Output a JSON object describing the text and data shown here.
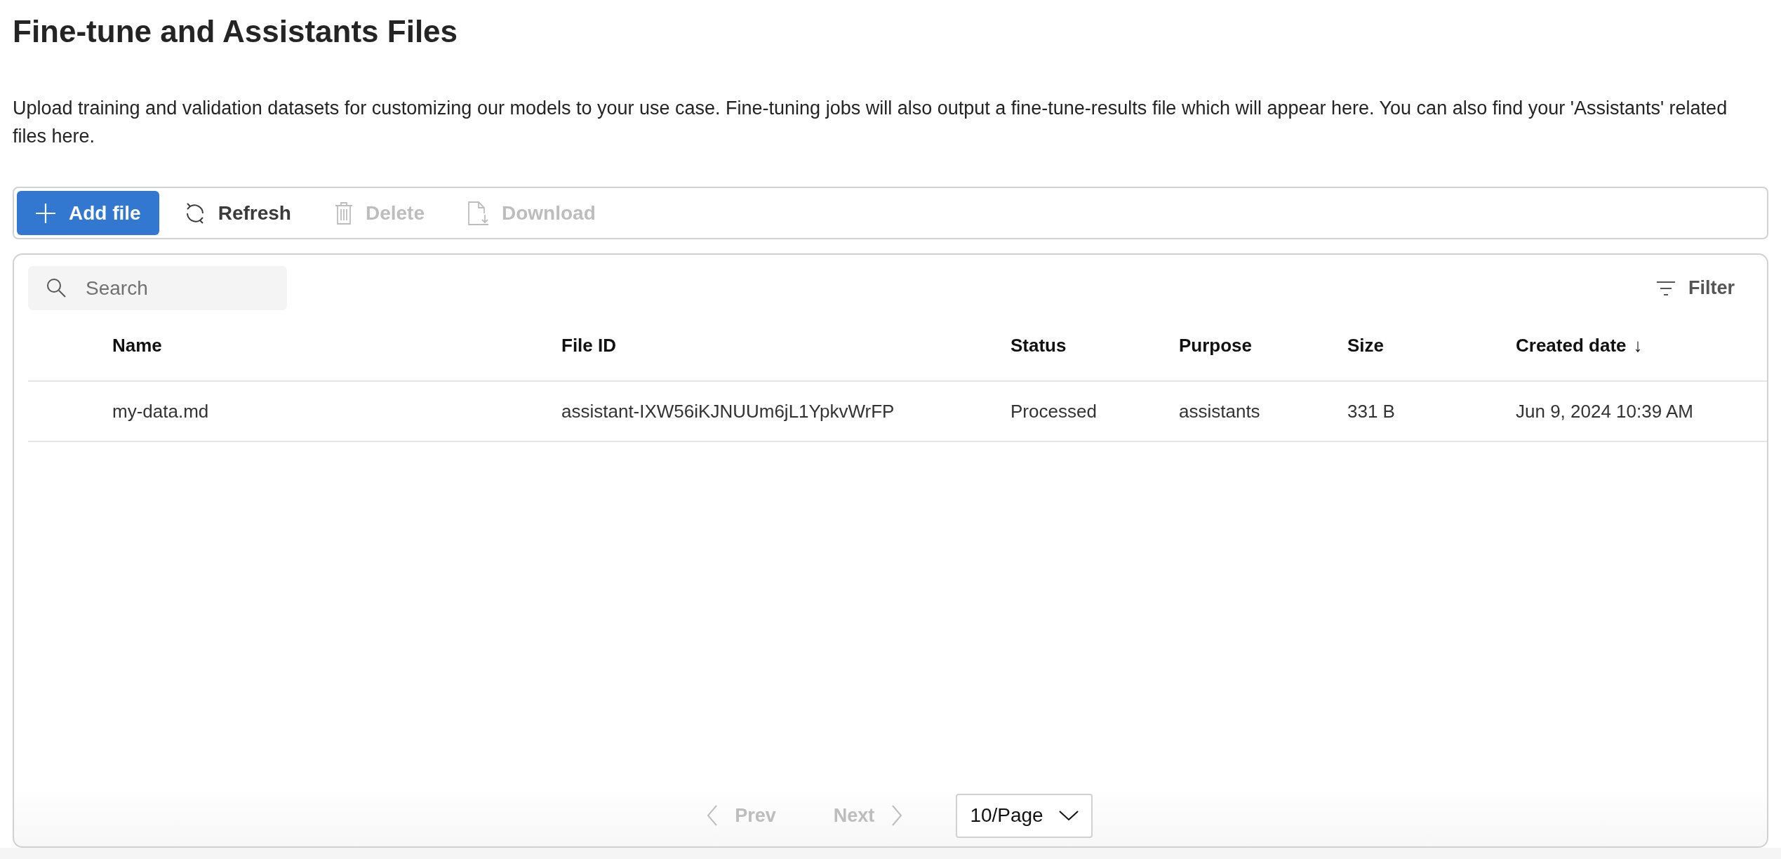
{
  "page": {
    "title": "Fine-tune and Assistants Files",
    "description": "Upload training and validation datasets for customizing our models to your use case. Fine-tuning jobs will also output a fine-tune-results file which will appear here. You can also find your 'Assistants' related files here."
  },
  "toolbar": [
    {
      "label": "Add file",
      "kind": "add",
      "primary": true,
      "disabled": false
    },
    {
      "label": "Refresh",
      "kind": "refresh",
      "primary": false,
      "disabled": false
    },
    {
      "label": "Delete",
      "kind": "delete",
      "primary": false,
      "disabled": true
    },
    {
      "label": "Download",
      "kind": "download",
      "primary": false,
      "disabled": true
    }
  ],
  "search": {
    "placeholder": "Search"
  },
  "filter": {
    "label": "Filter"
  },
  "table": {
    "columns": [
      {
        "label": "Name"
      },
      {
        "label": "File ID"
      },
      {
        "label": "Status"
      },
      {
        "label": "Purpose"
      },
      {
        "label": "Size"
      },
      {
        "label": "Created date",
        "sort_indicator": "↓"
      }
    ],
    "rows": [
      {
        "cells": [
          "my-data.md",
          "assistant-IXW56iKJNUUm6jL1YpkvWrFP",
          "Processed",
          "assistants",
          "331 B",
          "Jun 9, 2024 10:39 AM"
        ]
      }
    ]
  },
  "pagination": {
    "prev": {
      "label": "Prev",
      "disabled": true
    },
    "next": {
      "label": "Next",
      "disabled": true
    },
    "page_size": "10/Page"
  }
}
